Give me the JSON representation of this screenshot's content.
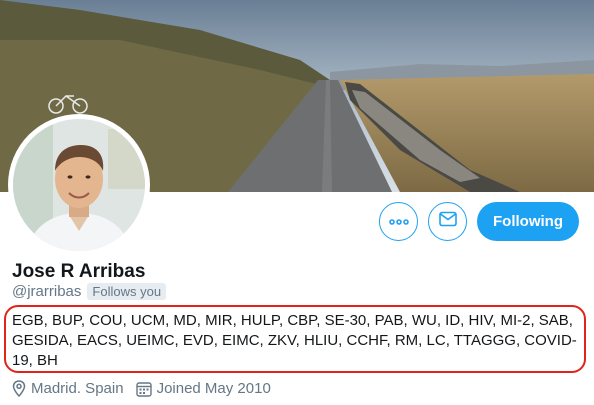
{
  "profile": {
    "name": "Jose R Arribas",
    "handle": "@jrarribas",
    "follows_you": "Follows you",
    "bio": "EGB, BUP, COU, UCM, MD, MIR, HULP, CBP, SE-30, PAB, WU, ID, HIV, MI-2, SAB, GESIDA, EACS, UEIMC, EVD, EIMC, ZKV, HLIU, CCHF, RM, LC, TTAGGG, COVID-19, BH",
    "location": "Madrid. Spain",
    "joined": "Joined May 2010"
  },
  "actions": {
    "following_label": "Following",
    "more_icon": "more-dots-icon",
    "message_icon": "envelope-icon"
  },
  "colors": {
    "accent": "#1da1f2",
    "annotation": "#e0241a",
    "secondary_text": "#657786"
  }
}
